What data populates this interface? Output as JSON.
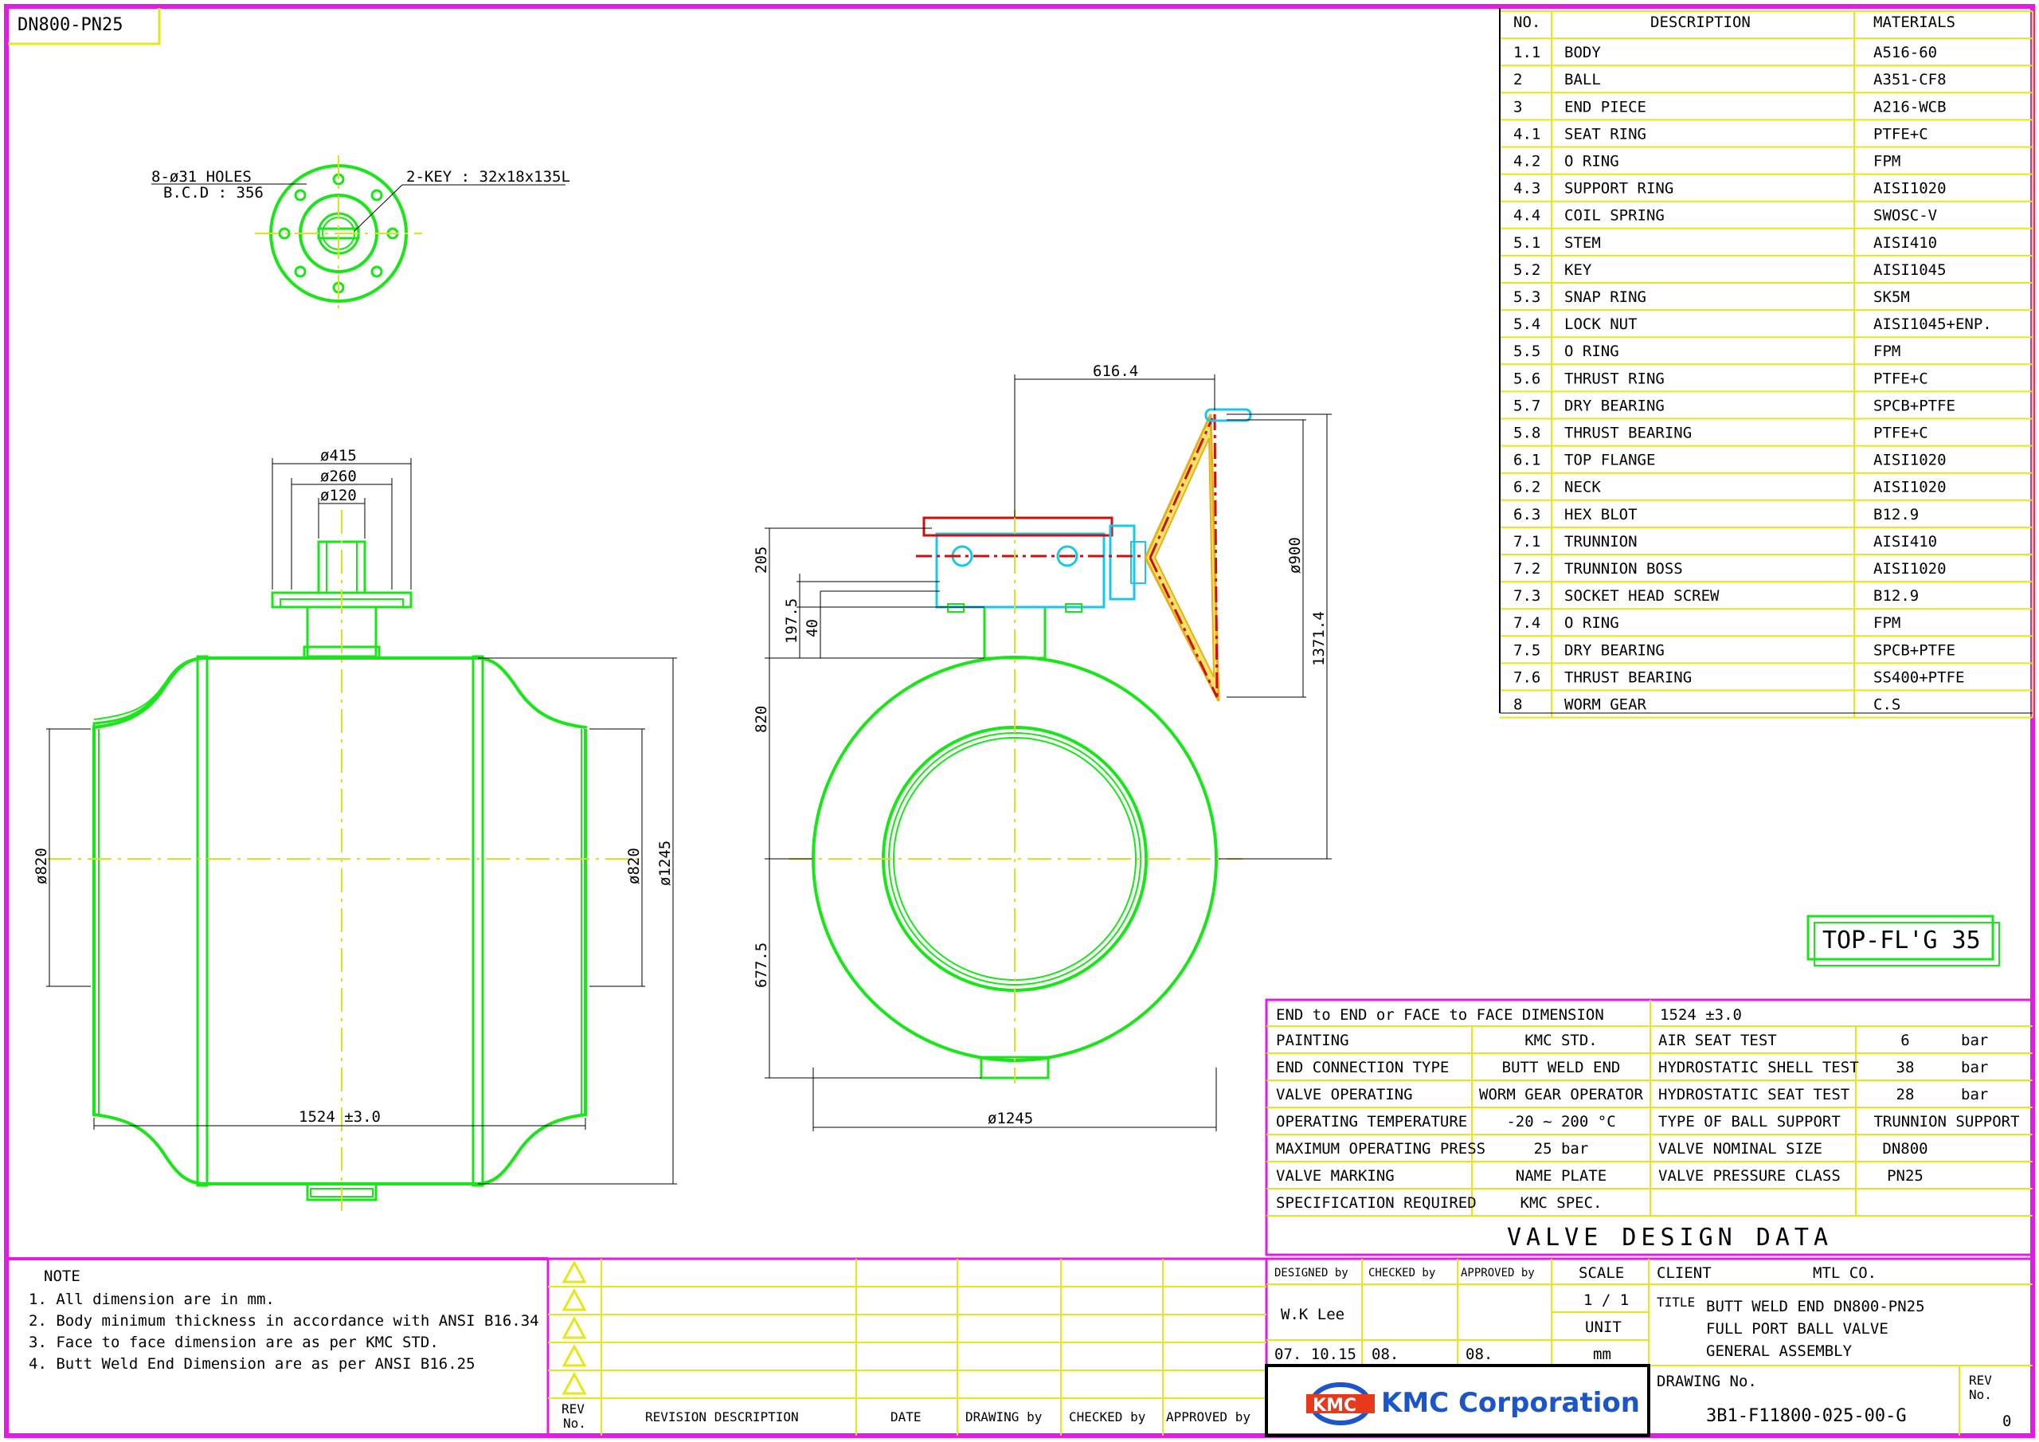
{
  "sheet_label": "DN800-PN25",
  "top_flange_label": "TOP-FL'G 35",
  "top_view": {
    "holes_label": "8-ø31 HOLES",
    "bcd_label": "B.C.D : 356",
    "key_label": "2-KEY : 32x18x135L"
  },
  "front_view": {
    "dim_415": "ø415",
    "dim_260": "ø260",
    "dim_120": "ø120",
    "dim_820_left": "ø820",
    "dim_820_right": "ø820",
    "dim_1245": "ø1245",
    "dim_length": "1524  ±3.0"
  },
  "side_view": {
    "dim_616": "616.4",
    "dim_900": "ø900",
    "dim_1371": "1371.4",
    "dim_205": "205",
    "dim_197": "197.5",
    "dim_40": "40",
    "dim_820": "820",
    "dim_677": "677.5",
    "dim_1245": "ø1245"
  },
  "bom": {
    "headers": [
      "NO.",
      "DESCRIPTION",
      "MATERIALS"
    ],
    "rows": [
      [
        "1.1",
        "BODY",
        "A516-60"
      ],
      [
        "2",
        "BALL",
        "A351-CF8"
      ],
      [
        "3",
        "END PIECE",
        "A216-WCB"
      ],
      [
        "4.1",
        "SEAT RING",
        "PTFE+C"
      ],
      [
        "4.2",
        "O RING",
        "FPM"
      ],
      [
        "4.3",
        "SUPPORT RING",
        "AISI1020"
      ],
      [
        "4.4",
        "COIL SPRING",
        "SWOSC-V"
      ],
      [
        "5.1",
        "STEM",
        "AISI410"
      ],
      [
        "5.2",
        "KEY",
        "AISI1045"
      ],
      [
        "5.3",
        "SNAP RING",
        "SK5M"
      ],
      [
        "5.4",
        "LOCK NUT",
        "AISI1045+ENP."
      ],
      [
        "5.5",
        "O RING",
        "FPM"
      ],
      [
        "5.6",
        "THRUST RING",
        "PTFE+C"
      ],
      [
        "5.7",
        "DRY BEARING",
        "SPCB+PTFE"
      ],
      [
        "5.8",
        "THRUST BEARING",
        "PTFE+C"
      ],
      [
        "6.1",
        "TOP FLANGE",
        "AISI1020"
      ],
      [
        "6.2",
        "NECK",
        "AISI1020"
      ],
      [
        "6.3",
        "HEX BLOT",
        "B12.9"
      ],
      [
        "7.1",
        "TRUNNION",
        "AISI410"
      ],
      [
        "7.2",
        "TRUNNION BOSS",
        "AISI1020"
      ],
      [
        "7.3",
        "SOCKET HEAD SCREW",
        "B12.9"
      ],
      [
        "7.4",
        "O RING",
        "FPM"
      ],
      [
        "7.5",
        "DRY BEARING",
        "SPCB+PTFE"
      ],
      [
        "7.6",
        "THRUST BEARING",
        "SS400+PTFE"
      ],
      [
        "8",
        "WORM GEAR",
        "C.S"
      ]
    ]
  },
  "design_data": {
    "end_to_end_label": "END to END or FACE to FACE DIMENSION",
    "end_to_end_value": "1524 ±3.0",
    "rows": [
      [
        "PAINTING",
        "KMC STD.",
        "AIR SEAT TEST",
        "6",
        "bar"
      ],
      [
        "END CONNECTION TYPE",
        "BUTT WELD END",
        "HYDROSTATIC SHELL TEST",
        "38",
        "bar"
      ],
      [
        "VALVE OPERATING",
        "WORM GEAR OPERATOR",
        "HYDROSTATIC SEAT TEST",
        "28",
        "bar"
      ],
      [
        "OPERATING TEMPERATURE",
        "-20 ~ 200  °C",
        "TYPE OF BALL SUPPORT",
        "TRUNNION SUPPORT",
        ""
      ],
      [
        "MAXIMUM OPERATING PRESS",
        "25     bar",
        "VALVE NOMINAL SIZE",
        "DN800",
        ""
      ],
      [
        "VALVE MARKING",
        "NAME PLATE",
        "VALVE PRESSURE CLASS",
        "PN25",
        ""
      ],
      [
        "SPECIFICATION REQUIRED",
        "KMC SPEC.",
        "",
        "",
        ""
      ]
    ],
    "title": "VALVE   DESIGN   DATA"
  },
  "notes": {
    "title": "NOTE",
    "items": [
      "1. All dimension are in mm.",
      "2. Body minimum thickness in accordance with ANSI B16.34",
      "3. Face to face dimension are as per KMC STD.",
      "4. Butt Weld End Dimension are as per ANSI B16.25"
    ]
  },
  "revision": {
    "rev_no": "REV\nNo.",
    "rev_no_line1": "REV",
    "rev_no_line2": "No.",
    "description": "REVISION DESCRIPTION",
    "date": "DATE",
    "drawing_by": "DRAWING by",
    "checked_by": "CHECKED by",
    "approved_by": "APPROVED by"
  },
  "title_block": {
    "designed_by_label": "DESIGNED   by",
    "checked_by_label": "CHECKED   by",
    "approved_by_label": "APPROVED   by",
    "scale_label": "SCALE",
    "scale_value": "1  /  1",
    "unit_label": "UNIT",
    "unit_value": "mm",
    "designer": "W.K Lee",
    "date_designed": "07. 10.15",
    "date_checked": "08.",
    "date_approved": "08.",
    "client_label": "CLIENT",
    "client_value": "MTL CO.",
    "title_label": "TITLE",
    "title_lines": [
      "BUTT WELD END DN800-PN25",
      "FULL PORT BALL VALVE",
      "GENERAL ASSEMBLY"
    ],
    "drawing_no_label": "DRAWING    No.",
    "drawing_no_value": "3B1-F11800-025-00-G",
    "rev_label_1": "REV",
    "rev_label_2": "No.",
    "rev_value": "0",
    "company_logo_text": "KMC",
    "company_name": "KMC Corporation"
  },
  "colors": {
    "border": "#e619e6",
    "grid": "#e6e619",
    "part": "#19e619",
    "actuator": "#e6c219",
    "gear_red": "#cc1010",
    "gear_cyan": "#19c8e6",
    "company": "#1b55c9"
  }
}
